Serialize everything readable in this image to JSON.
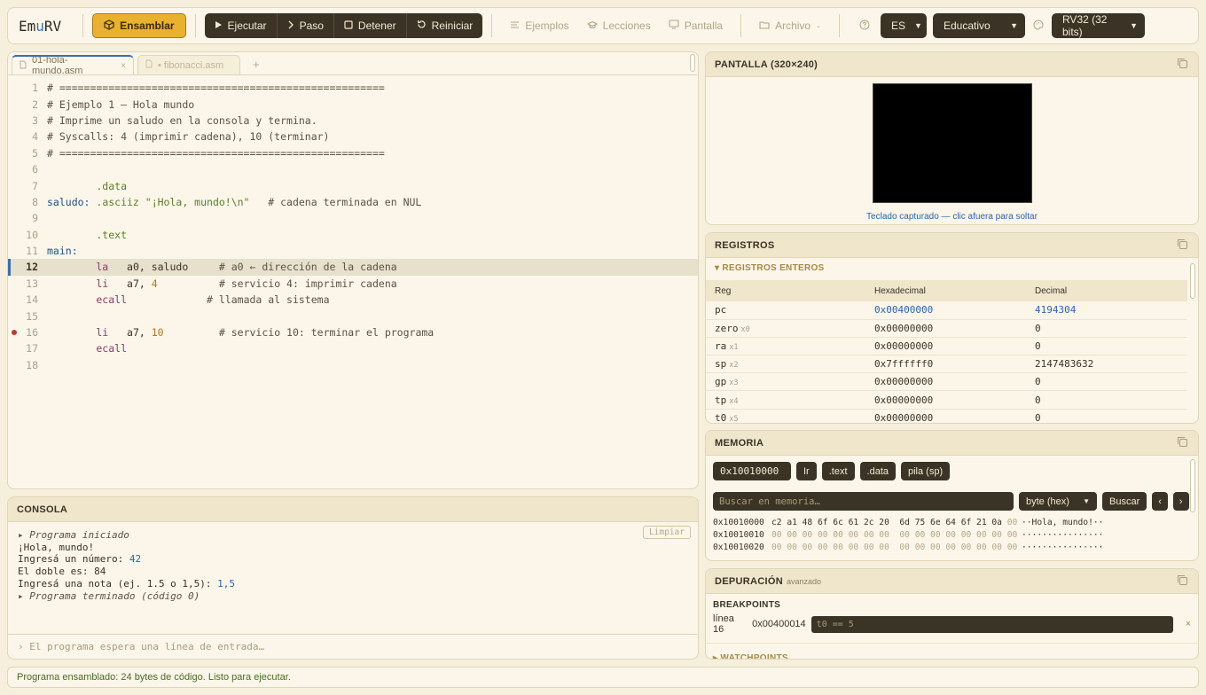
{
  "toolbar": {
    "logo_prefix": "Em",
    "logo_mu": "u",
    "logo_suffix": "RV",
    "assemble": "Ensamblar",
    "run": "Ejecutar",
    "step": "Paso",
    "stop": "Detener",
    "reset": "Reiniciar",
    "examples": "Ejemplos",
    "lessons": "Lecciones",
    "screen": "Pantalla",
    "file": "Archivo",
    "lang": "ES",
    "mode": "Educativo",
    "arch": "RV32 (32 bits)"
  },
  "editor": {
    "tabs": [
      {
        "label": "01-hola-mundo.asm",
        "close": "×"
      },
      {
        "label": "• fibonacci.asm"
      }
    ],
    "add_tab": "+",
    "lines": [
      {
        "n": "1",
        "text": "# ====================================================="
      },
      {
        "n": "2",
        "text": "# Ejemplo 1 — Hola mundo"
      },
      {
        "n": "3",
        "text": "# Imprime un saludo en la consola y termina."
      },
      {
        "n": "4",
        "text": "# Syscalls: 4 (imprimir cadena), 10 (terminar)"
      },
      {
        "n": "5",
        "text": "# ====================================================="
      },
      {
        "n": "6",
        "text": ""
      },
      {
        "n": "7",
        "dir": "        .data"
      },
      {
        "n": "8",
        "label": "saludo:",
        "dir": " .asciiz",
        "str": " \"¡Hola, mundo!\\n\"",
        "comment": "   # cadena terminada en NUL"
      },
      {
        "n": "9",
        "text": ""
      },
      {
        "n": "10",
        "dir": "        .text"
      },
      {
        "n": "11",
        "label": "main:"
      },
      {
        "n": "12",
        "kw": "        la",
        "args": "   a0, saludo",
        "comment": "     # a0 ← dirección de la cadena"
      },
      {
        "n": "13",
        "kw": "        li",
        "args": "   a7, ",
        "num": "4",
        "comment": "          # servicio 4: imprimir cadena"
      },
      {
        "n": "14",
        "kw": "        ecall",
        "comment": "             # llamada al sistema"
      },
      {
        "n": "15",
        "text": ""
      },
      {
        "n": "16",
        "kw": "        li",
        "args": "   a7, ",
        "num": "10",
        "comment": "         # servicio 10: terminar el programa"
      },
      {
        "n": "17",
        "kw": "        ecall"
      },
      {
        "n": "18",
        "text": ""
      }
    ]
  },
  "console": {
    "title": "CONSOLA",
    "clear": "Limpiar",
    "lines": [
      {
        "sys": "▸ Programa iniciado"
      },
      {
        "text": "¡Hola, mundo!"
      },
      {
        "text": "Ingresá un número: ",
        "inp": "42"
      },
      {
        "text": "El doble es: 84"
      },
      {
        "text": "Ingresá una nota (ej. 1.5 o 1,5): ",
        "inp": "1,5"
      },
      {
        "sys": "▸ Programa terminado (código 0)"
      }
    ],
    "input_placeholder": "›  El programa espera una línea de entrada…"
  },
  "screen": {
    "title": "PANTALLA (320×240)",
    "hint": "Teclado capturado — clic afuera para soltar"
  },
  "registers": {
    "title": "REGISTROS",
    "section": "▾ REGISTROS ENTEROS",
    "headers": [
      "Reg",
      "Hexadecimal",
      "Decimal"
    ],
    "rows": [
      {
        "reg": "pc",
        "alias": "",
        "hex": "0x00400000",
        "dec": "4194304"
      },
      {
        "reg": "zero",
        "alias": "x0",
        "hex": "0x00000000",
        "dec": "0"
      },
      {
        "reg": "ra",
        "alias": "x1",
        "hex": "0x00000000",
        "dec": "0"
      },
      {
        "reg": "sp",
        "alias": "x2",
        "hex": "0x7ffffff0",
        "dec": "2147483632"
      },
      {
        "reg": "gp",
        "alias": "x3",
        "hex": "0x00000000",
        "dec": "0"
      },
      {
        "reg": "tp",
        "alias": "x4",
        "hex": "0x00000000",
        "dec": "0"
      },
      {
        "reg": "t0",
        "alias": "x5",
        "hex": "0x00000000",
        "dec": "0"
      }
    ]
  },
  "memory": {
    "title": "MEMORIA",
    "address": "0x10010000",
    "go": "Ir",
    "text_btn": ".text",
    "data_btn": ".data",
    "stack_btn": "pila (sp)",
    "search_placeholder": "Buscar en memoria…",
    "format": "byte (hex)",
    "search_btn": "Buscar",
    "prev": "‹",
    "next": "›",
    "rows": [
      {
        "addr": "0x10010000",
        "hex": "c2 a1 48 6f 6c 61 2c 20  6d 75 6e 64 6f 21 0a ",
        "hex_dim": "00",
        "chars": "··Hola, mundo!··"
      },
      {
        "addr": "0x10010010",
        "hex": "",
        "hex_dim": "00 00 00 00 00 00 00 00  00 00 00 00 00 00 00 00",
        "chars": "················"
      },
      {
        "addr": "0x10010020",
        "hex": "",
        "hex_dim": "00 00 00 00 00 00 00 00  00 00 00 00 00 00 00 00",
        "chars": "················"
      }
    ]
  },
  "debug": {
    "title": "DEPURACIÓN",
    "subtitle": "avanzado",
    "breakpoints_title": "BREAKPOINTS",
    "bp_line": "línea 16",
    "bp_addr": "0x00400014",
    "bp_cond": "t0 == 5",
    "bp_delete": "×",
    "watchpoints_title": "▸ WATCHPOINTS"
  },
  "status": "Programa ensamblado: 24 bytes de código. Listo para ejecutar."
}
